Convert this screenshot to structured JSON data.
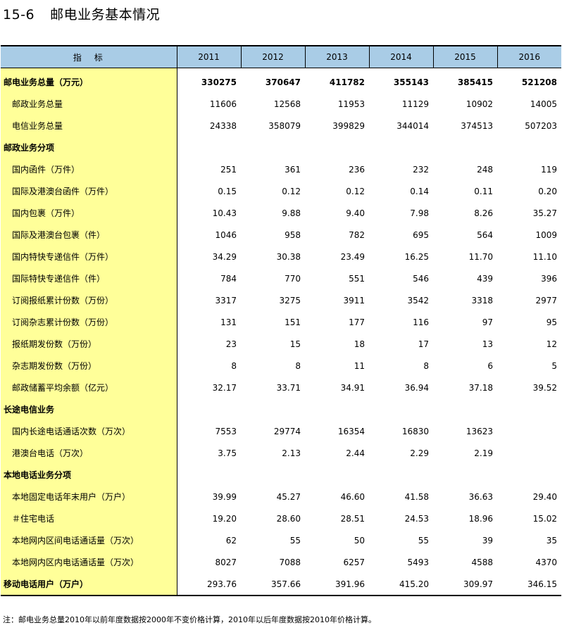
{
  "title": {
    "number": "15-6",
    "text": "邮电业务基本情况"
  },
  "table": {
    "header": {
      "label": "指标",
      "years": [
        "2011",
        "2012",
        "2013",
        "2014",
        "2015",
        "2016"
      ]
    },
    "rows": [
      {
        "label": "邮电业务总量（万元）",
        "values": [
          "330275",
          "370647",
          "411782",
          "355143",
          "385415",
          "521208"
        ]
      },
      {
        "label": "邮政业务总量",
        "values": [
          "11606",
          "12568",
          "11953",
          "11129",
          "10902",
          "14005"
        ]
      },
      {
        "label": "电信业务总量",
        "values": [
          "24338",
          "358079",
          "399829",
          "344014",
          "374513",
          "507203"
        ]
      },
      {
        "label": "邮政业务分项",
        "values": [
          "",
          "",
          "",
          "",
          "",
          ""
        ]
      },
      {
        "label": "国内函件（万件）",
        "values": [
          "251",
          "361",
          "236",
          "232",
          "248",
          "119"
        ]
      },
      {
        "label": "国际及港澳台函件（万件）",
        "values": [
          "0.15",
          "0.12",
          "0.12",
          "0.14",
          "0.11",
          "0.20"
        ]
      },
      {
        "label": "国内包裹（万件）",
        "values": [
          "10.43",
          "9.88",
          "9.40",
          "7.98",
          "8.26",
          "35.27"
        ]
      },
      {
        "label": "国际及港澳台包裹（件）",
        "values": [
          "1046",
          "958",
          "782",
          "695",
          "564",
          "1009"
        ]
      },
      {
        "label": "国内特快专递信件（万件）",
        "values": [
          "34.29",
          "30.38",
          "23.49",
          "16.25",
          "11.70",
          "11.10"
        ]
      },
      {
        "label": "国际特快专递信件（件）",
        "values": [
          "784",
          "770",
          "551",
          "546",
          "439",
          "396"
        ]
      },
      {
        "label": "订阅报纸累计份数（万份）",
        "values": [
          "3317",
          "3275",
          "3911",
          "3542",
          "3318",
          "2977"
        ]
      },
      {
        "label": "订阅杂志累计份数（万份）",
        "values": [
          "131",
          "151",
          "177",
          "116",
          "97",
          "95"
        ]
      },
      {
        "label": "报纸期发份数（万份）",
        "values": [
          "23",
          "15",
          "18",
          "17",
          "13",
          "12"
        ]
      },
      {
        "label": "杂志期发份数（万份）",
        "values": [
          "8",
          "8",
          "11",
          "8",
          "6",
          "5"
        ]
      },
      {
        "label": "邮政储蓄平均余额（亿元）",
        "values": [
          "32.17",
          "33.71",
          "34.91",
          "36.94",
          "37.18",
          "39.52"
        ]
      },
      {
        "label": "长途电信业务",
        "values": [
          "",
          "",
          "",
          "",
          "",
          ""
        ]
      },
      {
        "label": "国内长途电话通话次数（万次）",
        "values": [
          "7553",
          "29774",
          "16354",
          "16830",
          "13623",
          ""
        ]
      },
      {
        "label": "港澳台电话（万次）",
        "values": [
          "3.75",
          "2.13",
          "2.44",
          "2.29",
          "2.19",
          ""
        ]
      },
      {
        "label": "本地电话业务分项",
        "values": [
          "",
          "",
          "",
          "",
          "",
          ""
        ]
      },
      {
        "label": "本地固定电话年末用户（万户）",
        "values": [
          "39.99",
          "45.27",
          "46.60",
          "41.58",
          "36.63",
          "29.40"
        ]
      },
      {
        "label": "＃住宅电话",
        "values": [
          "19.20",
          "28.60",
          "28.51",
          "24.53",
          "18.96",
          "15.02"
        ]
      },
      {
        "label": "本地网内区间电话通话量（万次）",
        "values": [
          "62",
          "55",
          "50",
          "55",
          "39",
          "35"
        ]
      },
      {
        "label": "本地网内区内电话通话量（万次）",
        "values": [
          "8027",
          "7088",
          "6257",
          "5493",
          "4588",
          "4370"
        ]
      },
      {
        "label": "移动电话用户（万户）",
        "values": [
          "293.76",
          "357.66",
          "391.96",
          "415.20",
          "309.97",
          "346.15"
        ]
      }
    ]
  },
  "note": "注：邮电业务总量2010年以前年度数据按2000年不变价格计算，2010年以后年度数据按2010年价格计算。",
  "colors": {
    "header_bg": "#a9cce6",
    "label_bg": "#ffff99"
  }
}
